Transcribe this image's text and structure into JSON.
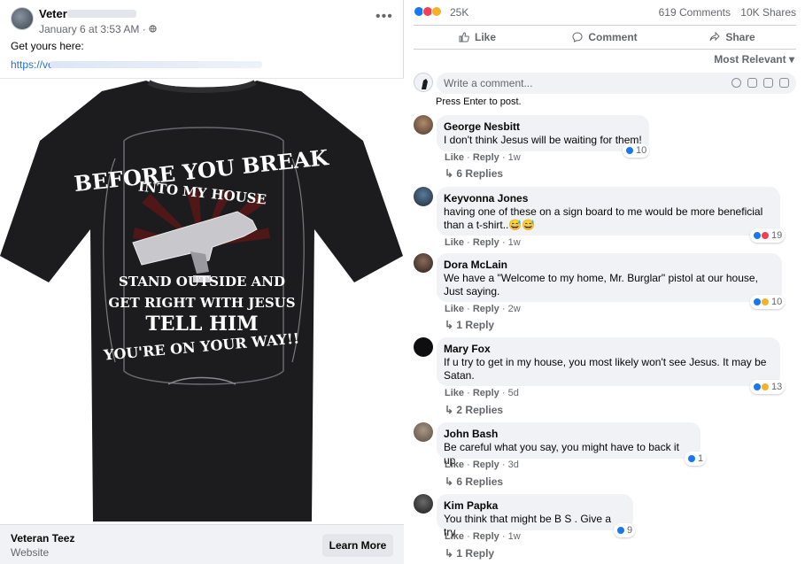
{
  "post": {
    "author": "Veter",
    "date": "January 6 at 3:53 AM",
    "privacy_icon": "globe-icon",
    "text": "Get yours here:",
    "link": "https://ve",
    "more_icon": "more-horizontal-icon",
    "shirt_text": {
      "line1": "BEFORE YOU BREAK",
      "line2": "INTO MY HOUSE",
      "line3": "STAND OUTSIDE AND",
      "line4": "GET RIGHT WITH JESUS",
      "line5": "TELL HIM",
      "line6": "YOU'RE ON YOUR WAY!!"
    },
    "cta": {
      "title": "Veteran Teez",
      "subtitle": "Website",
      "button": "Learn More"
    }
  },
  "stats": {
    "reactions": "25K",
    "comments": "619 Comments",
    "shares": "10K Shares",
    "reaction_types": [
      "like",
      "love",
      "haha"
    ]
  },
  "actions": {
    "like": "Like",
    "comment": "Comment",
    "share": "Share"
  },
  "sort": "Most Relevant",
  "composer": {
    "placeholder": "Write a comment...",
    "hint": "Press Enter to post."
  },
  "comments": [
    {
      "name": "George Nesbitt",
      "text": "I don't think Jesus will be waiting for them!",
      "like": "Like",
      "reply": "Reply",
      "time": "1w",
      "reactions": "10",
      "replies": "6 Replies"
    },
    {
      "name": "Keyvonna Jones",
      "text": "having one of these on a sign board to me would be more beneficial\nthan a t-shirt..😅😅",
      "like": "Like",
      "reply": "Reply",
      "time": "1w",
      "reactions": "19",
      "replies": ""
    },
    {
      "name": "Dora McLain",
      "text": "We have a \"Welcome to my home, Mr. Burglar\" pistol at our house,\nJust saying.",
      "like": "Like",
      "reply": "Reply",
      "time": "2w",
      "reactions": "10",
      "replies": "1 Reply"
    },
    {
      "name": "Mary Fox",
      "text": "If u try to get in my house, you most likely won't see Jesus. It may be\nSatan.",
      "like": "Like",
      "reply": "Reply",
      "time": "5d",
      "reactions": "13",
      "replies": "2 Replies"
    },
    {
      "name": "John Bash",
      "text": "Be careful what you say, you might have to back it up.",
      "like": "Like",
      "reply": "Reply",
      "time": "3d",
      "reactions": "1",
      "replies": "6 Replies"
    },
    {
      "name": "Kim Papka",
      "text": "You think that might be B S . Give a try.",
      "like": "Like",
      "reply": "Reply",
      "time": "1w",
      "reactions": "9",
      "replies": "1 Reply"
    }
  ],
  "dot": "·",
  "colors": {
    "link": "#216fdb",
    "like_blue": "#1877f2",
    "love_red": "#f33e58",
    "haha_yellow": "#f7b125",
    "muted": "#65676b"
  }
}
